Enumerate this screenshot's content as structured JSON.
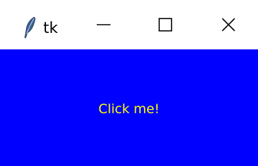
{
  "window": {
    "title": "tk",
    "app_icon": "feather-icon",
    "controls": {
      "minimize_icon": "minimize-icon",
      "maximize_icon": "maximize-icon",
      "close_icon": "close-icon"
    }
  },
  "content": {
    "background_color": "#0000ff",
    "button_label": "Click me!",
    "button_text_color": "#ffff00"
  }
}
